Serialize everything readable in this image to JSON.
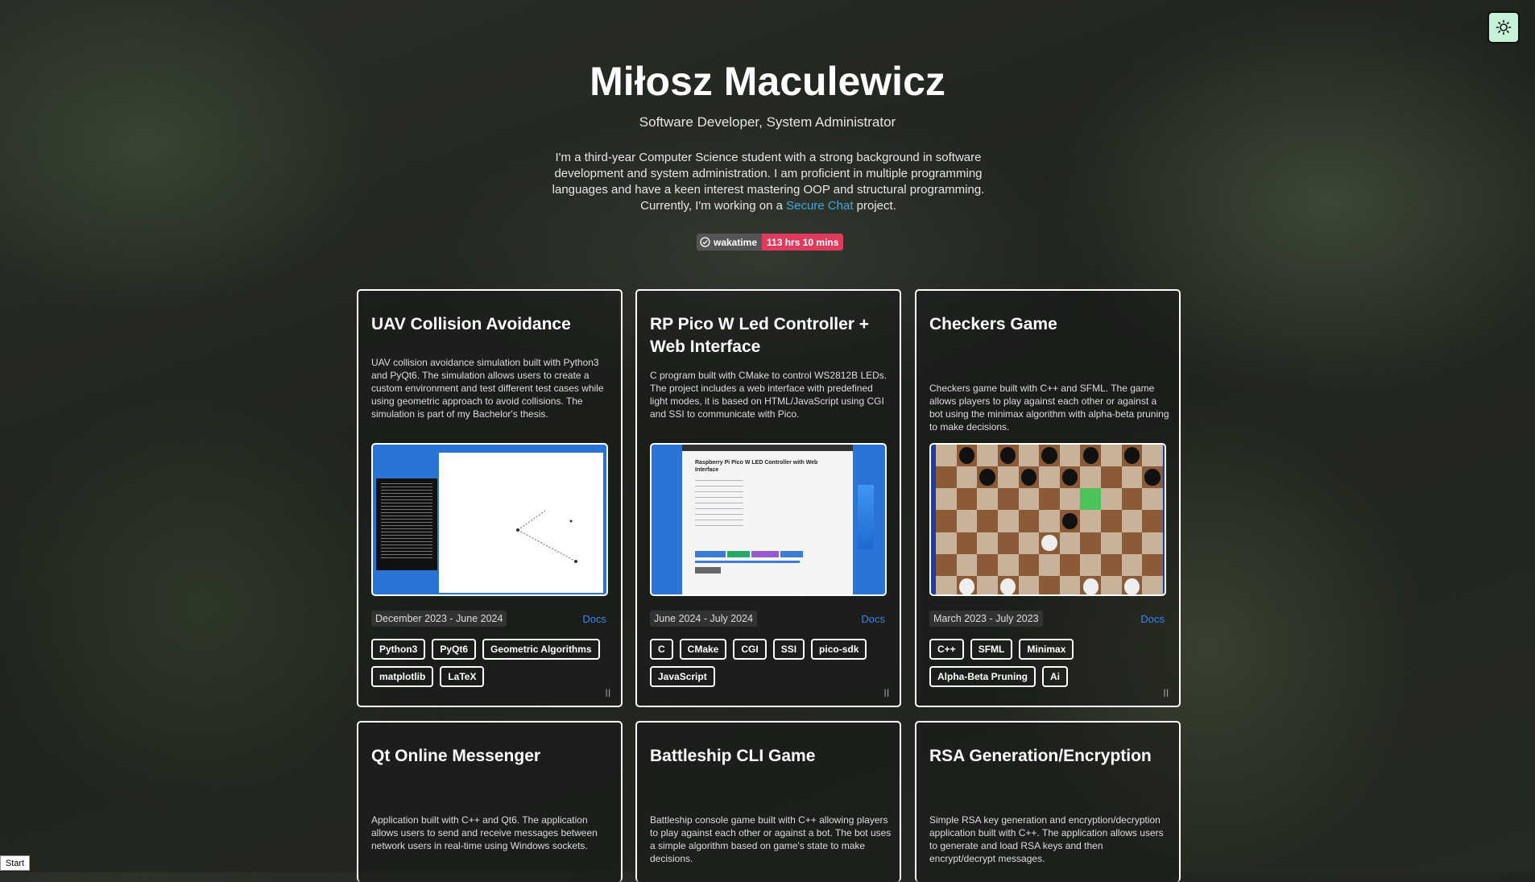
{
  "header": {
    "name": "Miłosz Maculewicz",
    "role": "Software Developer, System Administrator",
    "bio_text": "I'm a third-year Computer Science student with a strong background in software development and system administration. I am proficient in multiple programming languages and have a keen interest mastering OOP and structural programming. Currently, I'm working on a ",
    "bio_link": "Secure Chat",
    "bio_end": " project.",
    "badge_label": "wakatime",
    "badge_value": "113 hrs 10 mins"
  },
  "theme_icon": "sun-icon",
  "colors": {
    "link": "#3ea6e0",
    "badge": "#e03b5d",
    "docs": "#3b82f6",
    "toggle": "#c7f2d8"
  },
  "projects": [
    {
      "title": "UAV Collision Avoidance",
      "desc": "UAV collision avoidance simulation built with Python3 and PyQt6. The simulation allows users to create a custom environment and test different test cases while using geometric approach to avoid collisions. The simulation is part of my Bachelor's thesis.",
      "date": "December 2023 - June 2024",
      "docs": "Docs",
      "tags": [
        "Python3",
        "PyQt6",
        "Geometric Algorithms",
        "matplotlib",
        "LaTeX"
      ]
    },
    {
      "title": "RP Pico W Led Controller + Web Interface",
      "desc": "C program built with CMake to control WS2812B LEDs. The project includes a web interface with predefined light modes, it is based on HTML/JavaScript using CGI and SSI to communicate with Pico.",
      "date": "June 2024 - July 2024",
      "docs": "Docs",
      "tags": [
        "C",
        "CMake",
        "CGI",
        "SSI",
        "pico-sdk",
        "JavaScript"
      ],
      "shot_title": "Raspberry Pi Pico W LED Controller with Web Interface"
    },
    {
      "title": "Checkers Game",
      "desc": "Checkers game built with C++ and SFML. The game allows players to play against each other or against a bot using the minimax algorithm with alpha-beta pruning to make decisions.",
      "date": "March 2023 - July 2023",
      "docs": "Docs",
      "tags": [
        "C++",
        "SFML",
        "Minimax",
        "Alpha-Beta Pruning",
        "Ai"
      ]
    },
    {
      "title": "Qt Online Messenger",
      "desc": "Application built with C++ and Qt6. The application allows users to send and receive messages between network users in real-time using Windows sockets."
    },
    {
      "title": "Battleship CLI Game",
      "desc": "Battleship console game built with C++ allowing players to play against each other or against a bot. The bot uses a simple algorithm based on game's state to make decisions."
    },
    {
      "title": "RSA Generation/Encryption",
      "desc": "Simple RSA key generation and encryption/decryption application built with C++. The application allows users to generate and load RSA keys and then encrypt/decrypt messages."
    }
  ],
  "taskbar": {
    "start": "Start"
  }
}
